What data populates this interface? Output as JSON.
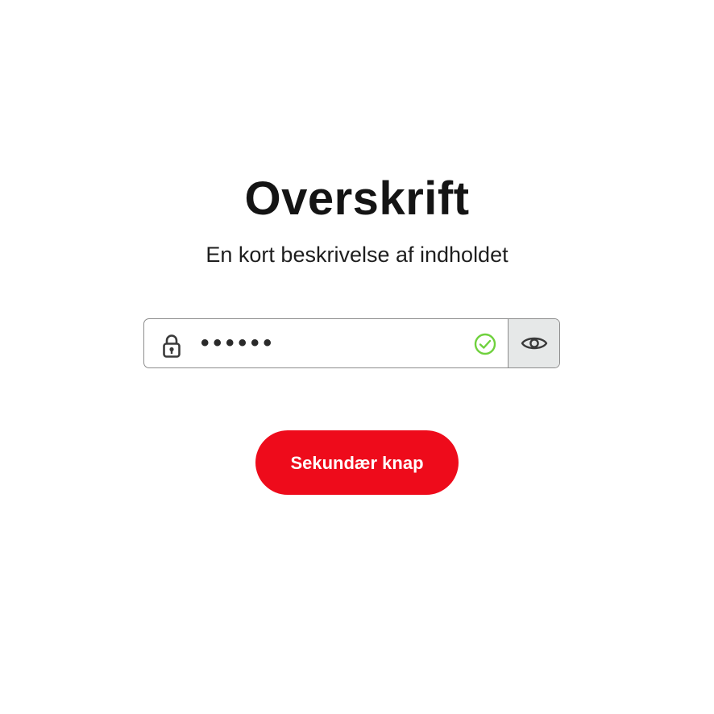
{
  "header": {
    "title": "Overskrift",
    "subtitle": "En kort beskrivelse af indholdet"
  },
  "password_field": {
    "value": "••••••",
    "leading_icon": "lock-icon",
    "status_icon": "check-circle-icon",
    "status": "valid",
    "toggle_icon": "eye-icon"
  },
  "buttons": {
    "secondary_label": "Sekundær knap"
  },
  "colors": {
    "accent": "#ee0b1b",
    "valid": "#6fd13d",
    "toggle_bg": "#e6e8e8",
    "border": "#8c8c8c"
  }
}
